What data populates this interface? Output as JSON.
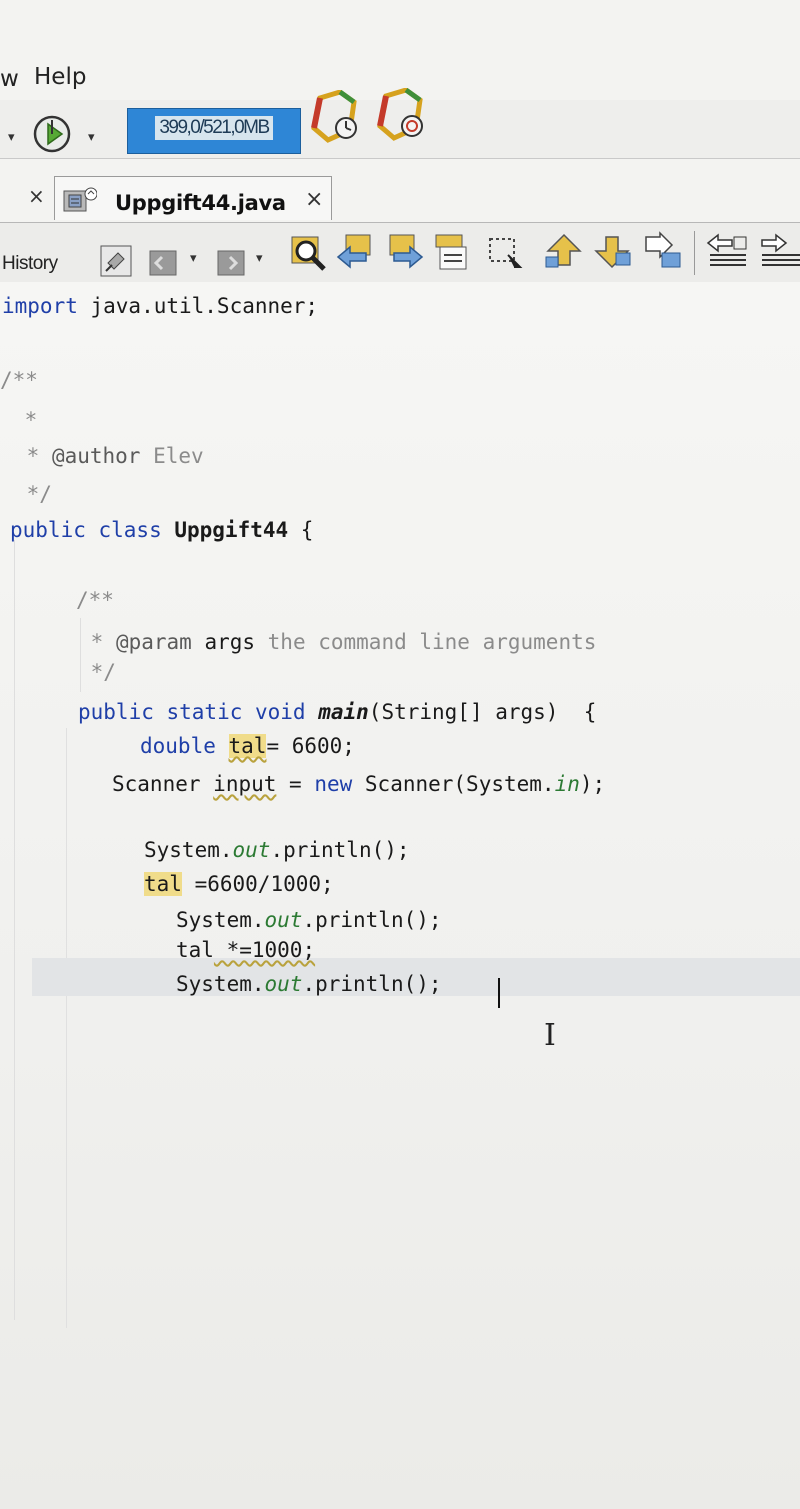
{
  "menu": {
    "partial_item": "w",
    "help": "Help"
  },
  "toolbar": {
    "memory_usage": "399,0/521,0MB"
  },
  "tabs": {
    "active_file": "Uppgift44.java",
    "close_glyph": "×"
  },
  "editor_toolbar": {
    "history_label": "History"
  },
  "icons": {
    "run_clock": "clock-run-icon",
    "garbage_collect": "gc-icon",
    "file": "java-file-icon"
  },
  "code": {
    "l1_import_kw": "import",
    "l1_rest": " java.util.Scanner;",
    "l2": "/**",
    "l3": " *",
    "l4_star": " * ",
    "l4_tag": "@author",
    "l4_rest": " Elev",
    "l5": " */",
    "l6_kw": "public class",
    "l6_name": " Uppgift44",
    "l6_rest": " {",
    "l7": "/**",
    "l8_star": " * ",
    "l8_tag": "@param",
    "l8_arg": " args",
    "l8_rest": " the command line arguments",
    "l9": " */",
    "l10_kw": "public static void",
    "l10_name": " main",
    "l10_rest": "(String[] args)  {",
    "l11_kw": "double",
    "l11_var": "tal",
    "l11_rest": "= 6600;",
    "l12_type": "Scanner",
    "l12_var": "input",
    "l12_eq": " = ",
    "l12_new": "new",
    "l12_rest": " Scanner(System.",
    "l12_in": "in",
    "l12_end": ");",
    "l13_sys": "System.",
    "l13_out": "out",
    "l13_rest": ".println();",
    "l14_var": "tal",
    "l14_rest": " =6600/1000;",
    "l15_sys": "System.",
    "l15_out": "out",
    "l15_rest": ".println();",
    "l16_var": "tal",
    "l16_rest": " *=1000;",
    "l17_sys": "System.",
    "l17_out": "out",
    "l17_rest": ".println();"
  },
  "colors": {
    "keyword": "#1f3fa8",
    "comment": "#8b8b8b",
    "highlight": "#f0dc8a",
    "memory_bar": "#2e86d6"
  }
}
